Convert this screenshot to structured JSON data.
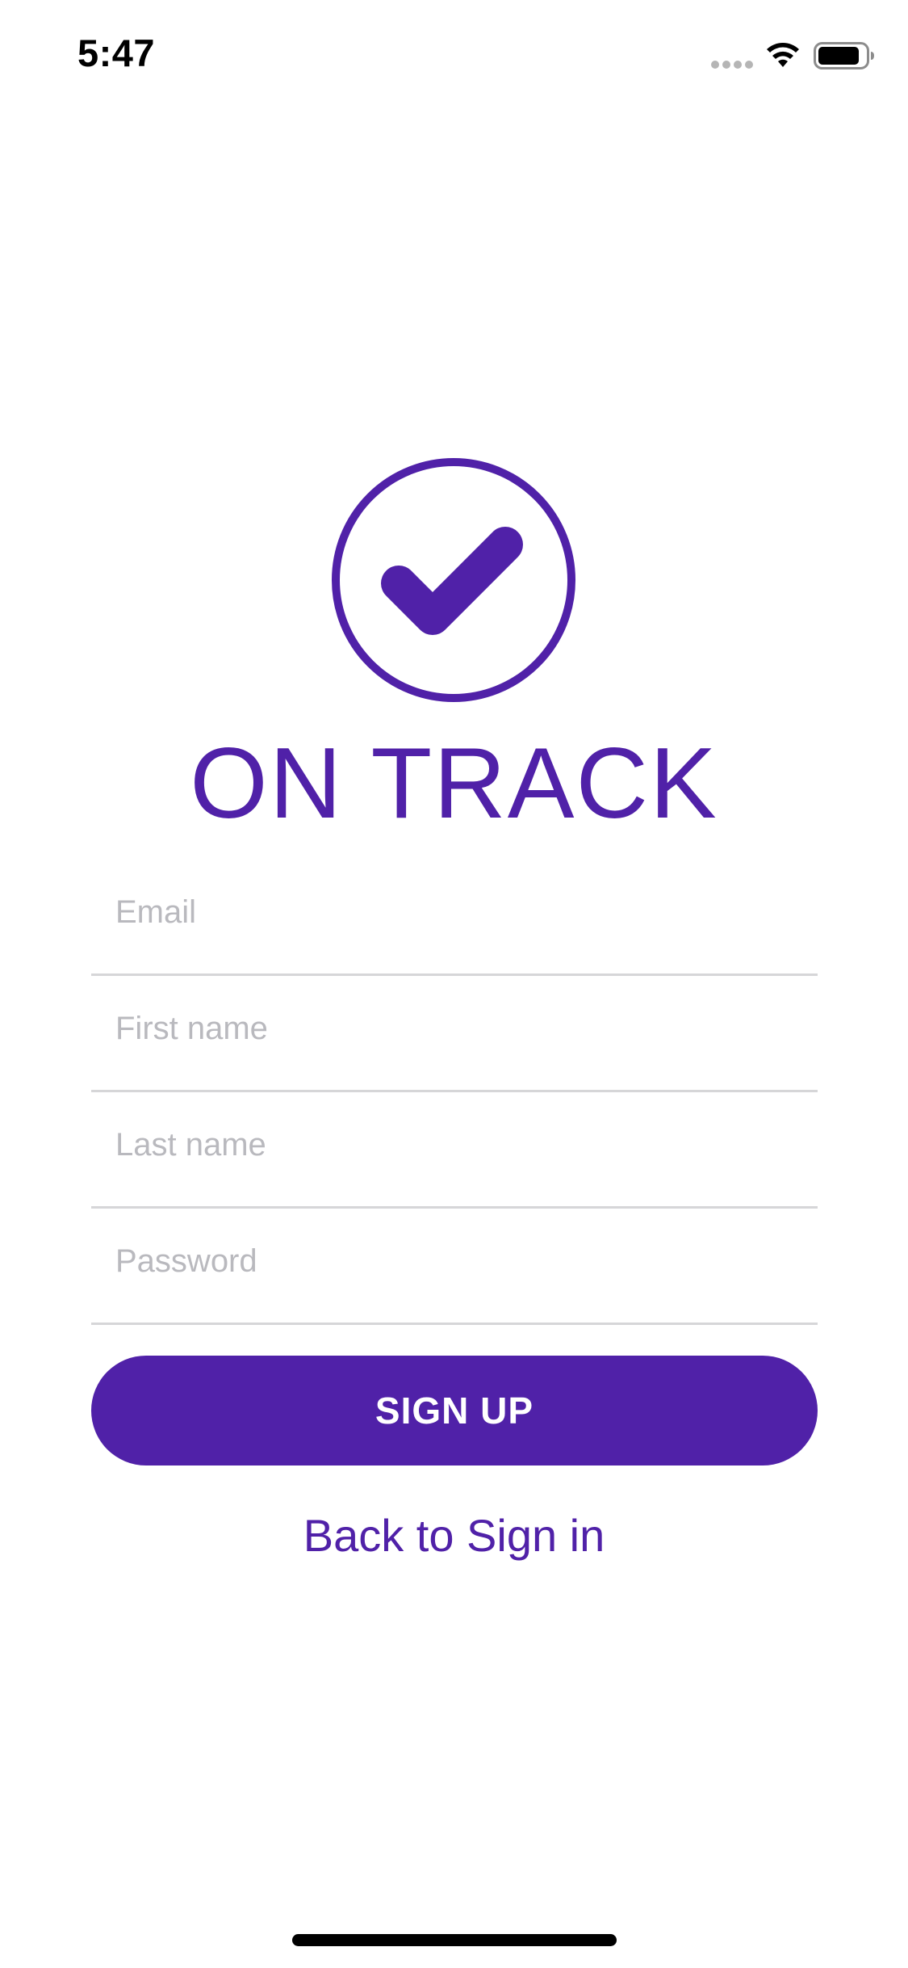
{
  "status_bar": {
    "time": "5:47",
    "icons": [
      "signal-icon",
      "wifi-icon",
      "battery-icon"
    ]
  },
  "app": {
    "title": "ON TRACK",
    "logo_icon": "checkmark-circle-icon",
    "accent_color": "#5021a8"
  },
  "form": {
    "email_placeholder": "Email",
    "email_value": "",
    "first_name_placeholder": "First name",
    "first_name_value": "",
    "last_name_placeholder": "Last name",
    "last_name_value": "",
    "password_placeholder": "Password",
    "password_value": ""
  },
  "actions": {
    "signup_label": "SIGN UP",
    "back_label": "Back to Sign in"
  }
}
